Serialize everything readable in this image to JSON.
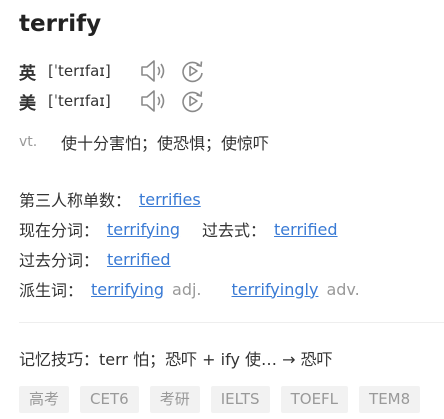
{
  "word": "terrify",
  "pronunciations": [
    {
      "region": "英",
      "phonetic": "[ˈterɪfaɪ]",
      "speaker_icon": "speaker-icon",
      "replay_icon": "replay-icon"
    },
    {
      "region": "美",
      "phonetic": "[ˈterɪfaɪ]",
      "speaker_icon": "speaker-icon",
      "replay_icon": "replay-icon"
    }
  ],
  "definition": {
    "pos": "vt.",
    "text": "使十分害怕；使恐惧；使惊吓"
  },
  "forms": {
    "third_person": {
      "label": "第三人称单数：",
      "value": "terrifies"
    },
    "present_participle": {
      "label": "现在分词：",
      "value": "terrifying"
    },
    "past_tense": {
      "label": "过去式：",
      "value": "terrified"
    },
    "past_participle": {
      "label": "过去分词：",
      "value": "terrified"
    },
    "derived": {
      "label": "派生词：",
      "items": [
        {
          "word": "terrifying",
          "pos": "adj."
        },
        {
          "word": "terrifyingly",
          "pos": "adv."
        }
      ]
    }
  },
  "memory_tip": "记忆技巧：terr 怕；恐吓 + ify 使… → 恐吓",
  "tags": [
    "高考",
    "CET6",
    "考研",
    "IELTS",
    "TOEFL",
    "TEM8"
  ],
  "colors": {
    "link": "#3a7bd5",
    "muted": "#999999",
    "tag_bg": "#f2f2f2"
  }
}
